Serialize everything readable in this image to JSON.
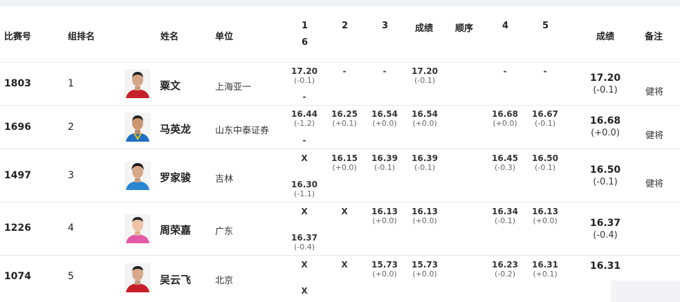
{
  "header": {
    "bib": "比赛号",
    "group_rank": "组排名",
    "name": "姓名",
    "unit": "单位",
    "t1": "1",
    "t6": "6",
    "t2": "2",
    "t3": "3",
    "result_mid": "成绩",
    "order": "顺序",
    "t4": "4",
    "t5": "5",
    "result": "成绩",
    "note": "备注"
  },
  "rows": [
    {
      "bib": "1803",
      "rank": "1",
      "name": "粟文",
      "unit": "上海亚一",
      "a1": {
        "v": "17.20",
        "w": "(-0.1)"
      },
      "a6": {
        "v": "-",
        "w": ""
      },
      "a2": {
        "v": "-",
        "w": ""
      },
      "a3": {
        "v": "-",
        "w": ""
      },
      "mid": {
        "v": "17.20",
        "w": "(-0.1)"
      },
      "a4": {
        "v": "-",
        "w": ""
      },
      "a5": {
        "v": "-",
        "w": ""
      },
      "best": {
        "v": "17.20",
        "w": "(-0.1)"
      },
      "note": "健将",
      "shirt": "#c8202a"
    },
    {
      "bib": "1696",
      "rank": "2",
      "name": "马英龙",
      "unit": "山东中泰证券",
      "a1": {
        "v": "16.44",
        "w": "(-1.2)"
      },
      "a6": {
        "v": "-",
        "w": ""
      },
      "a2": {
        "v": "16.25",
        "w": "(+0.1)"
      },
      "a3": {
        "v": "16.54",
        "w": "(+0.0)"
      },
      "mid": {
        "v": "16.54",
        "w": "(+0.0)"
      },
      "a4": {
        "v": "16.68",
        "w": "(+0.0)"
      },
      "a5": {
        "v": "16.67",
        "w": "(-0.1)"
      },
      "best": {
        "v": "16.68",
        "w": "(+0.0)"
      },
      "note": "健将",
      "shirt": "#1f6fc4"
    },
    {
      "bib": "1497",
      "rank": "3",
      "name": "罗家骏",
      "unit": "吉林",
      "a1": {
        "v": "X",
        "w": ""
      },
      "a6": {
        "v": "16.30",
        "w": "(-1.1)"
      },
      "a2": {
        "v": "16.15",
        "w": "(+0.0)"
      },
      "a3": {
        "v": "16.39",
        "w": "(-0.1)"
      },
      "mid": {
        "v": "16.39",
        "w": "(-0.1)"
      },
      "a4": {
        "v": "16.45",
        "w": "(-0.3)"
      },
      "a5": {
        "v": "16.50",
        "w": "(-0.1)"
      },
      "best": {
        "v": "16.50",
        "w": "(-0.1)"
      },
      "note": "健将",
      "shirt": "#2a86d1"
    },
    {
      "bib": "1226",
      "rank": "4",
      "name": "周荣嘉",
      "unit": "广东",
      "a1": {
        "v": "X",
        "w": ""
      },
      "a6": {
        "v": "16.37",
        "w": "(-0.4)"
      },
      "a2": {
        "v": "X",
        "w": ""
      },
      "a3": {
        "v": "16.13",
        "w": "(+0.0)"
      },
      "mid": {
        "v": "16.13",
        "w": "(+0.0)"
      },
      "a4": {
        "v": "16.34",
        "w": "(-0.1)"
      },
      "a5": {
        "v": "16.13",
        "w": "(+0.0)"
      },
      "best": {
        "v": "16.37",
        "w": "(-0.4)"
      },
      "note": "",
      "shirt": "#e25aa8"
    },
    {
      "bib": "1074",
      "rank": "5",
      "name": "吴云飞",
      "unit": "北京",
      "a1": {
        "v": "X",
        "w": ""
      },
      "a6": {
        "v": "X",
        "w": ""
      },
      "a2": {
        "v": "X",
        "w": ""
      },
      "a3": {
        "v": "15.73",
        "w": "(+0.0)"
      },
      "mid": {
        "v": "15.73",
        "w": "(+0.0)"
      },
      "a4": {
        "v": "16.23",
        "w": "(-0.2)"
      },
      "a5": {
        "v": "16.31",
        "w": "(+0.1)"
      },
      "best": {
        "v": "16.31",
        "w": ""
      },
      "note": "",
      "shirt": "#c8202a"
    }
  ]
}
